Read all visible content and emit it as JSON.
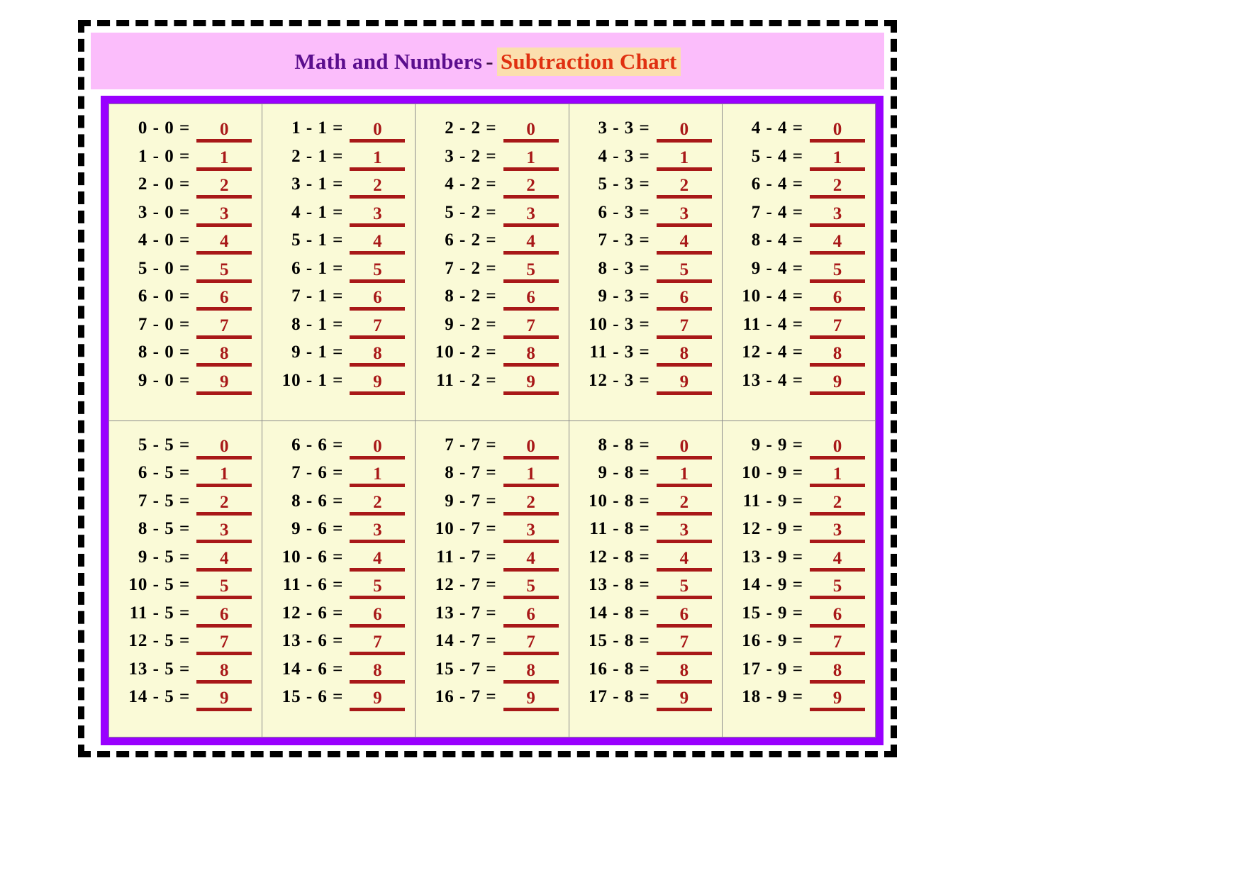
{
  "title": {
    "main": "Math and Numbers",
    "separator": "-",
    "accent": "Subtraction Chart"
  },
  "colors": {
    "frame_border": "#000000",
    "title_band_bg": "#FBBDFB",
    "title_main_color": "#5B0E8E",
    "title_accent_color": "#E03010",
    "title_accent_bg": "#FBDFAE",
    "table_border": "#9900FF",
    "cell_bg": "#FAFAD7",
    "cell_divider": "#8C8C8C",
    "expression_color": "#000000",
    "answer_color": "#A81818"
  },
  "chart_data": {
    "type": "table",
    "title": "Math and Numbers - Subtraction Chart",
    "layout": {
      "rows": 2,
      "columns": 5,
      "lines_per_cell": 10
    },
    "cells": [
      {
        "subtrahend": 0,
        "lines": [
          {
            "expr": "0 - 0 =",
            "answer": "0"
          },
          {
            "expr": "1 - 0 =",
            "answer": "1"
          },
          {
            "expr": "2 - 0 =",
            "answer": "2"
          },
          {
            "expr": "3 - 0 =",
            "answer": "3"
          },
          {
            "expr": "4 - 0 =",
            "answer": "4"
          },
          {
            "expr": "5 - 0 =",
            "answer": "5"
          },
          {
            "expr": "6 - 0 =",
            "answer": "6"
          },
          {
            "expr": "7 - 0 =",
            "answer": "7"
          },
          {
            "expr": "8 - 0 =",
            "answer": "8"
          },
          {
            "expr": "9 - 0 =",
            "answer": "9"
          }
        ]
      },
      {
        "subtrahend": 1,
        "lines": [
          {
            "expr": "1 - 1 =",
            "answer": "0"
          },
          {
            "expr": "2 - 1 =",
            "answer": "1"
          },
          {
            "expr": "3 - 1 =",
            "answer": "2"
          },
          {
            "expr": "4 - 1 =",
            "answer": "3"
          },
          {
            "expr": "5 - 1 =",
            "answer": "4"
          },
          {
            "expr": "6 - 1 =",
            "answer": "5"
          },
          {
            "expr": "7 - 1 =",
            "answer": "6"
          },
          {
            "expr": "8 - 1 =",
            "answer": "7"
          },
          {
            "expr": "9 - 1 =",
            "answer": "8"
          },
          {
            "expr": "10 - 1 =",
            "answer": "9"
          }
        ]
      },
      {
        "subtrahend": 2,
        "lines": [
          {
            "expr": "2 - 2 =",
            "answer": "0"
          },
          {
            "expr": "3 - 2 =",
            "answer": "1"
          },
          {
            "expr": "4 - 2 =",
            "answer": "2"
          },
          {
            "expr": "5 - 2 =",
            "answer": "3"
          },
          {
            "expr": "6 - 2 =",
            "answer": "4"
          },
          {
            "expr": "7 - 2 =",
            "answer": "5"
          },
          {
            "expr": "8 - 2 =",
            "answer": "6"
          },
          {
            "expr": "9 - 2 =",
            "answer": "7"
          },
          {
            "expr": "10 - 2 =",
            "answer": "8"
          },
          {
            "expr": "11 - 2 =",
            "answer": "9"
          }
        ]
      },
      {
        "subtrahend": 3,
        "lines": [
          {
            "expr": "3 - 3 =",
            "answer": "0"
          },
          {
            "expr": "4 - 3 =",
            "answer": "1"
          },
          {
            "expr": "5 - 3 =",
            "answer": "2"
          },
          {
            "expr": "6 - 3 =",
            "answer": "3"
          },
          {
            "expr": "7 - 3 =",
            "answer": "4"
          },
          {
            "expr": "8 - 3 =",
            "answer": "5"
          },
          {
            "expr": "9 - 3 =",
            "answer": "6"
          },
          {
            "expr": "10 - 3 =",
            "answer": "7"
          },
          {
            "expr": "11 - 3 =",
            "answer": "8"
          },
          {
            "expr": "12 - 3 =",
            "answer": "9"
          }
        ]
      },
      {
        "subtrahend": 4,
        "lines": [
          {
            "expr": "4 - 4 =",
            "answer": "0"
          },
          {
            "expr": "5 - 4 =",
            "answer": "1"
          },
          {
            "expr": "6 - 4 =",
            "answer": "2"
          },
          {
            "expr": "7 - 4 =",
            "answer": "3"
          },
          {
            "expr": "8 - 4 =",
            "answer": "4"
          },
          {
            "expr": "9 - 4 =",
            "answer": "5"
          },
          {
            "expr": "10 - 4 =",
            "answer": "6"
          },
          {
            "expr": "11 - 4 =",
            "answer": "7"
          },
          {
            "expr": "12 - 4 =",
            "answer": "8"
          },
          {
            "expr": "13 - 4 =",
            "answer": "9"
          }
        ]
      },
      {
        "subtrahend": 5,
        "lines": [
          {
            "expr": "5 - 5 =",
            "answer": "0"
          },
          {
            "expr": "6 - 5 =",
            "answer": "1"
          },
          {
            "expr": "7 - 5 =",
            "answer": "2"
          },
          {
            "expr": "8 - 5 =",
            "answer": "3"
          },
          {
            "expr": "9 - 5 =",
            "answer": "4"
          },
          {
            "expr": "10 - 5 =",
            "answer": "5"
          },
          {
            "expr": "11 - 5 =",
            "answer": "6"
          },
          {
            "expr": "12 - 5 =",
            "answer": "7"
          },
          {
            "expr": "13 - 5 =",
            "answer": "8"
          },
          {
            "expr": "14 - 5 =",
            "answer": "9"
          }
        ]
      },
      {
        "subtrahend": 6,
        "lines": [
          {
            "expr": "6 - 6 =",
            "answer": "0"
          },
          {
            "expr": "7 - 6 =",
            "answer": "1"
          },
          {
            "expr": "8 - 6 =",
            "answer": "2"
          },
          {
            "expr": "9 - 6 =",
            "answer": "3"
          },
          {
            "expr": "10 - 6 =",
            "answer": "4"
          },
          {
            "expr": "11 - 6 =",
            "answer": "5"
          },
          {
            "expr": "12 - 6 =",
            "answer": "6"
          },
          {
            "expr": "13 - 6 =",
            "answer": "7"
          },
          {
            "expr": "14 - 6 =",
            "answer": "8"
          },
          {
            "expr": "15 - 6 =",
            "answer": "9"
          }
        ]
      },
      {
        "subtrahend": 7,
        "lines": [
          {
            "expr": "7 - 7 =",
            "answer": "0"
          },
          {
            "expr": "8 - 7 =",
            "answer": "1"
          },
          {
            "expr": "9 - 7 =",
            "answer": "2"
          },
          {
            "expr": "10 - 7 =",
            "answer": "3"
          },
          {
            "expr": "11 - 7 =",
            "answer": "4"
          },
          {
            "expr": "12 - 7 =",
            "answer": "5"
          },
          {
            "expr": "13 - 7 =",
            "answer": "6"
          },
          {
            "expr": "14 - 7 =",
            "answer": "7"
          },
          {
            "expr": "15 - 7 =",
            "answer": "8"
          },
          {
            "expr": "16 - 7 =",
            "answer": "9"
          }
        ]
      },
      {
        "subtrahend": 8,
        "lines": [
          {
            "expr": "8 - 8 =",
            "answer": "0"
          },
          {
            "expr": "9 - 8 =",
            "answer": "1"
          },
          {
            "expr": "10 - 8 =",
            "answer": "2"
          },
          {
            "expr": "11 - 8 =",
            "answer": "3"
          },
          {
            "expr": "12 - 8 =",
            "answer": "4"
          },
          {
            "expr": "13 - 8 =",
            "answer": "5"
          },
          {
            "expr": "14 - 8 =",
            "answer": "6"
          },
          {
            "expr": "15 - 8 =",
            "answer": "7"
          },
          {
            "expr": "16 - 8 =",
            "answer": "8"
          },
          {
            "expr": "17 - 8 =",
            "answer": "9"
          }
        ]
      },
      {
        "subtrahend": 9,
        "lines": [
          {
            "expr": "9 - 9 =",
            "answer": "0"
          },
          {
            "expr": "10 - 9 =",
            "answer": "1"
          },
          {
            "expr": "11 - 9 =",
            "answer": "2"
          },
          {
            "expr": "12 - 9 =",
            "answer": "3"
          },
          {
            "expr": "13 - 9 =",
            "answer": "4"
          },
          {
            "expr": "14 - 9 =",
            "answer": "5"
          },
          {
            "expr": "15 - 9 =",
            "answer": "6"
          },
          {
            "expr": "16 - 9 =",
            "answer": "7"
          },
          {
            "expr": "17 - 9 =",
            "answer": "8"
          },
          {
            "expr": "18 - 9 =",
            "answer": "9"
          }
        ]
      }
    ]
  }
}
